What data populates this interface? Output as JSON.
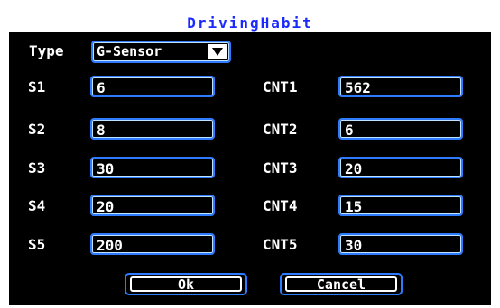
{
  "window": {
    "title": "DrivingHabit"
  },
  "type_row": {
    "label": "Type",
    "selected": "G-Sensor"
  },
  "rows": [
    {
      "s_label": "S1",
      "s_value": "6",
      "cnt_label": "CNT1",
      "cnt_value": "562"
    },
    {
      "s_label": "S2",
      "s_value": "8",
      "cnt_label": "CNT2",
      "cnt_value": "6"
    },
    {
      "s_label": "S3",
      "s_value": "30",
      "cnt_label": "CNT3",
      "cnt_value": "20"
    },
    {
      "s_label": "S4",
      "s_value": "20",
      "cnt_label": "CNT4",
      "cnt_value": "15"
    },
    {
      "s_label": "S5",
      "s_value": "200",
      "cnt_label": "CNT5",
      "cnt_value": "30"
    }
  ],
  "buttons": {
    "ok": "Ok",
    "cancel": "Cancel"
  },
  "colors": {
    "title_text": "#1a2aff",
    "field_border": "#2e7bff",
    "background": "#000000"
  },
  "icons": {
    "dropdown": "chevron-down-icon"
  }
}
